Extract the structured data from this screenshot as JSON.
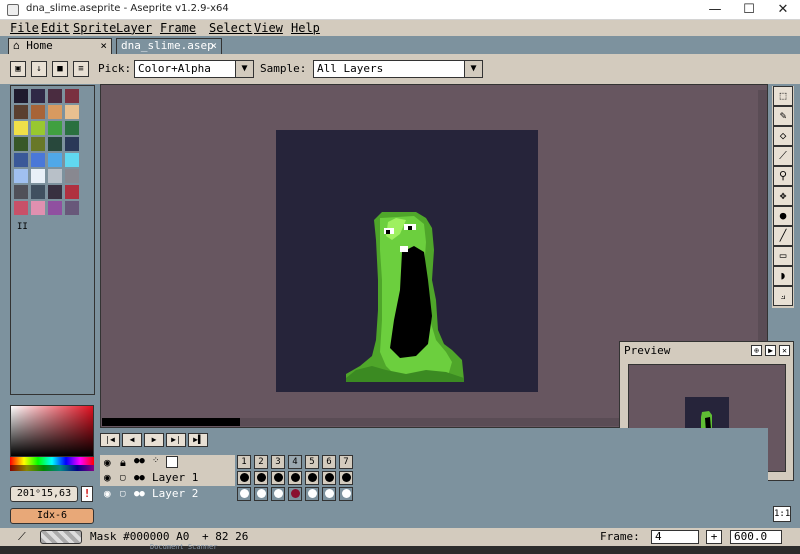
{
  "window": {
    "title": "dna_slime.aseprite - Aseprite v1.2.9-x64",
    "min": "—",
    "max": "☐",
    "close": "✕"
  },
  "menu": [
    "File",
    "Edit",
    "Sprite",
    "Layer",
    "Frame",
    "Select",
    "View",
    "Help"
  ],
  "tabs": {
    "home": {
      "label": "Home",
      "close": "×"
    },
    "file": {
      "label": "dna_slime.asep",
      "close": "×"
    }
  },
  "toolbar": {
    "pick_label": "Pick:",
    "pick_value": "Color+Alpha",
    "sample_label": "Sample:",
    "sample_value": "All Layers"
  },
  "palette": {
    "colors": [
      "#1f1b2e",
      "#2f2846",
      "#4a2c40",
      "#7a3040",
      "#5a4030",
      "#a86438",
      "#d89a60",
      "#e8c090",
      "#f0e048",
      "#98c830",
      "#40a040",
      "#2a7040",
      "#385828",
      "#687828",
      "#28483c",
      "#2a3858",
      "#3a5898",
      "#4a78d8",
      "#50a8e8",
      "#60d8f0",
      "#a0c0f0",
      "#e8f0f8",
      "#b8c0c8",
      "#888890",
      "#505058",
      "#405060",
      "#383040",
      "#b03040",
      "#c85068",
      "#e090b0",
      "#9050a0",
      "#68587a"
    ],
    "marker": "II"
  },
  "colors": {
    "fg_value": "201ᵒ15,63",
    "index": "Idx-6",
    "accent": "#e8a878",
    "bg_ui": "#d3cbbe"
  },
  "timeline": {
    "frames": [
      "1",
      "2",
      "3",
      "4",
      "5",
      "6",
      "7"
    ],
    "current_frame": "4",
    "layers": [
      {
        "name": "Layer 1"
      },
      {
        "name": "Layer 2"
      }
    ]
  },
  "preview": {
    "title": "Preview"
  },
  "status": {
    "mask": "Mask #000000 A0",
    "cursor": "+ 82 26",
    "frame_label": "Frame:",
    "frame_value": "4",
    "plus": "+",
    "zoom": "600.0",
    "one_to_one": "1:1"
  },
  "taskbar_remnant": "Document Scanner"
}
